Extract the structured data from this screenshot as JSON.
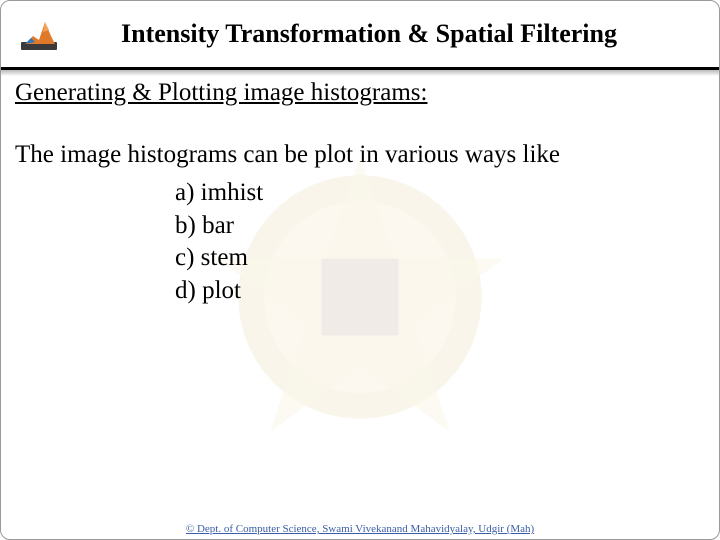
{
  "header": {
    "title": "Intensity Transformation & Spatial Filtering",
    "logo_name": "matlab-logo"
  },
  "content": {
    "subtitle": "Generating & Plotting image histograms:",
    "body_text": "The image histograms can be plot in various ways like",
    "items": {
      "a": "a) imhist",
      "b": "b) bar",
      "c": "c) stem",
      "d": "d) plot"
    }
  },
  "footer": {
    "text": "© Dept. of Computer Science, Swami Vivekanand Mahavidyalay, Udgir (Mah)"
  }
}
